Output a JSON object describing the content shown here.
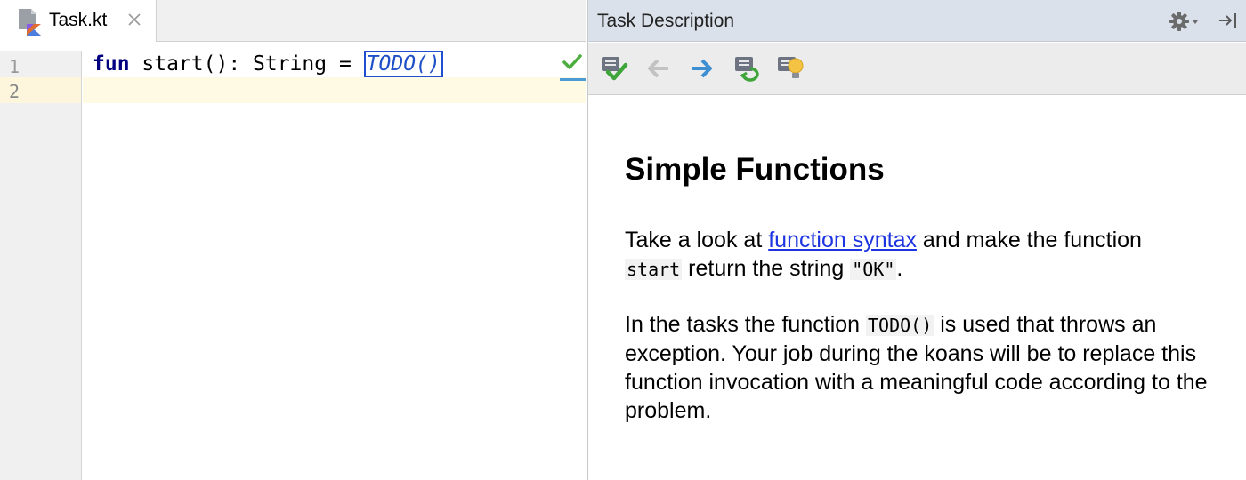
{
  "editor": {
    "tab": {
      "file_name": "Task.kt",
      "icon": "kotlin-file-icon",
      "close_icon": "close-icon"
    },
    "line_numbers": [
      "1",
      "2"
    ],
    "code_line_1": {
      "keyword": "fun",
      "signature": " start(): String = ",
      "call": "TODO()"
    },
    "status_icon": "check-icon"
  },
  "task_panel": {
    "title": "Task Description",
    "header_icons": [
      "gear-icon",
      "hide-panel-icon"
    ],
    "toolbar_icons": [
      "check-task-icon",
      "previous-task-icon",
      "next-task-icon",
      "refresh-task-icon",
      "hint-icon"
    ],
    "heading": "Simple Functions",
    "para1": {
      "before": "Take a look at ",
      "link": "function syntax",
      "middle": " and make the function",
      "code1": "start",
      "middle2": " return the string ",
      "code2": "\"OK\"",
      "end": "."
    },
    "para2": {
      "before": "In the tasks the function ",
      "code": "TODO()",
      "after": " is used that throws an exception. Your job during the koans will be to replace this function invocation with a meaningful code according to the problem."
    }
  },
  "colors": {
    "keyword": "#000080",
    "todo": "#2050c8",
    "link": "#1d35e0",
    "check_green": "#4cae3e",
    "arrow_blue": "#3d8fd1",
    "header_bg": "#dbe1ea"
  }
}
